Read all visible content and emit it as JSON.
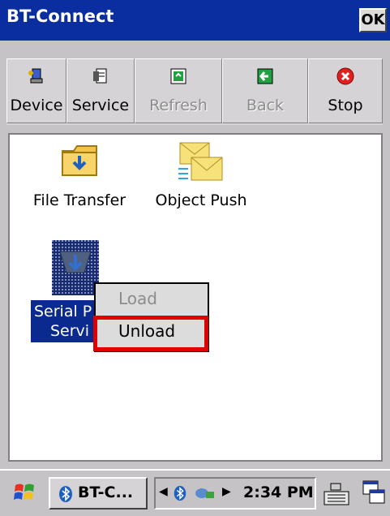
{
  "window": {
    "title": "BT-Connect",
    "ok_label": "OK"
  },
  "toolbar": {
    "buttons": [
      {
        "label": "Device",
        "icon": "device-icon",
        "enabled": true
      },
      {
        "label": "Service",
        "icon": "service-icon",
        "enabled": true
      },
      {
        "label": "Refresh",
        "icon": "refresh-icon",
        "enabled": false
      },
      {
        "label": "Back",
        "icon": "back-arrow-icon",
        "enabled": false
      },
      {
        "label": "Stop",
        "icon": "stop-icon",
        "enabled": true
      }
    ]
  },
  "services": [
    {
      "label": "File Transfer",
      "icon": "folder-transfer-icon"
    },
    {
      "label": "Object Push",
      "icon": "envelope-push-icon"
    },
    {
      "label_line1": "Serial P",
      "label_line2": "Servi",
      "icon": "serial-port-icon",
      "selected": true
    }
  ],
  "context_menu": {
    "items": [
      {
        "label": "Load",
        "enabled": false
      },
      {
        "label": "Unload",
        "enabled": true,
        "highlighted": true
      }
    ]
  },
  "taskbar": {
    "task_label": "BT-C...",
    "clock": "2:34 PM",
    "colors": {
      "accent": "#0a2ea0",
      "highlight": "#e00000"
    }
  }
}
